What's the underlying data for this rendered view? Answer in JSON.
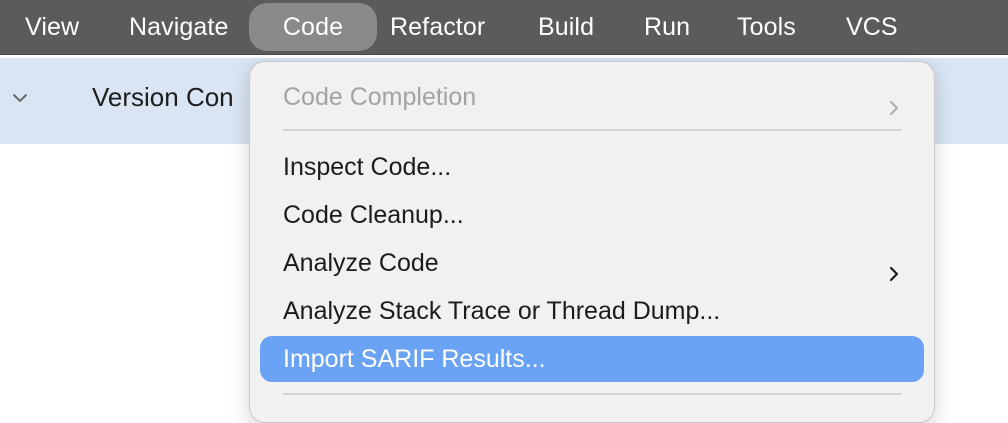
{
  "menubar": {
    "items": [
      {
        "label": "View"
      },
      {
        "label": "Navigate"
      },
      {
        "label": "Code",
        "active": true
      },
      {
        "label": "Refactor"
      },
      {
        "label": "Build"
      },
      {
        "label": "Run"
      },
      {
        "label": "Tools"
      },
      {
        "label": "VCS"
      }
    ]
  },
  "tree": {
    "row_label": "Version Con",
    "chevron_icon": "chevron-down-icon"
  },
  "code_menu": {
    "items": [
      {
        "label": "Code Completion",
        "disabled": true,
        "submenu": true
      },
      {
        "label": "Inspect Code..."
      },
      {
        "label": "Code Cleanup..."
      },
      {
        "label": "Analyze Code",
        "submenu": true
      },
      {
        "label": "Analyze Stack Trace or Thread Dump..."
      },
      {
        "label": "Import SARIF Results...",
        "highlighted": true
      }
    ]
  },
  "colors": {
    "menubar_bg": "#5b5b5e",
    "active_menu_bg": "#8a8a8c",
    "tree_row_bg": "#d9e5f3",
    "dropdown_bg": "#f1f1f2",
    "highlight": "#6aa2f4",
    "disabled_text": "#a3a3a6"
  }
}
